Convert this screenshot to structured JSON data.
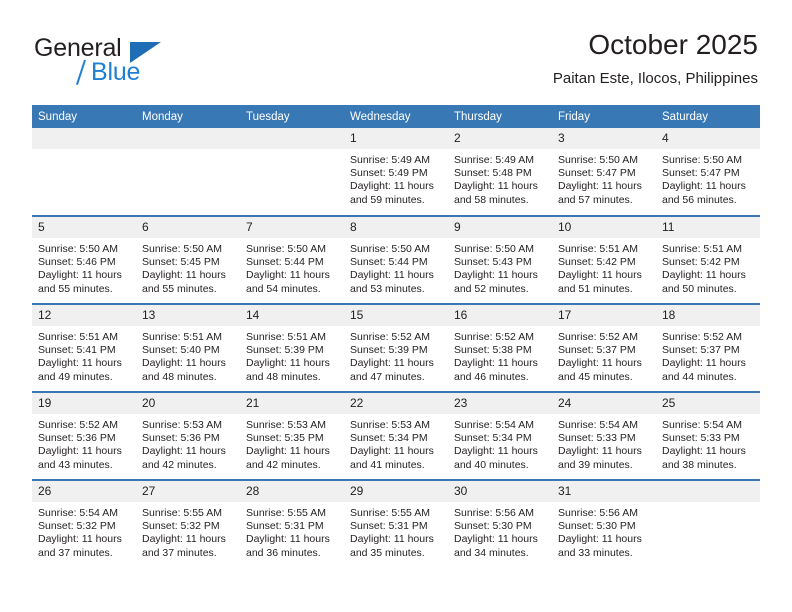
{
  "brand": {
    "name_part1": "General",
    "name_part2": "Blue",
    "triangle_color": "#1f6db5",
    "blue_color": "#1f7fd4"
  },
  "header": {
    "title": "October 2025",
    "subtitle": "Paitan Este, Ilocos, Philippines",
    "header_bg": "#3878b4",
    "daynum_bg": "#f0f0f0"
  },
  "weekday_headers": [
    "Sunday",
    "Monday",
    "Tuesday",
    "Wednesday",
    "Thursday",
    "Friday",
    "Saturday"
  ],
  "weeks": [
    [
      {
        "day": "",
        "sunrise": "",
        "sunset": "",
        "daylight": ""
      },
      {
        "day": "",
        "sunrise": "",
        "sunset": "",
        "daylight": ""
      },
      {
        "day": "",
        "sunrise": "",
        "sunset": "",
        "daylight": ""
      },
      {
        "day": "1",
        "sunrise": "Sunrise: 5:49 AM",
        "sunset": "Sunset: 5:49 PM",
        "daylight": "Daylight: 11 hours and 59 minutes."
      },
      {
        "day": "2",
        "sunrise": "Sunrise: 5:49 AM",
        "sunset": "Sunset: 5:48 PM",
        "daylight": "Daylight: 11 hours and 58 minutes."
      },
      {
        "day": "3",
        "sunrise": "Sunrise: 5:50 AM",
        "sunset": "Sunset: 5:47 PM",
        "daylight": "Daylight: 11 hours and 57 minutes."
      },
      {
        "day": "4",
        "sunrise": "Sunrise: 5:50 AM",
        "sunset": "Sunset: 5:47 PM",
        "daylight": "Daylight: 11 hours and 56 minutes."
      }
    ],
    [
      {
        "day": "5",
        "sunrise": "Sunrise: 5:50 AM",
        "sunset": "Sunset: 5:46 PM",
        "daylight": "Daylight: 11 hours and 55 minutes."
      },
      {
        "day": "6",
        "sunrise": "Sunrise: 5:50 AM",
        "sunset": "Sunset: 5:45 PM",
        "daylight": "Daylight: 11 hours and 55 minutes."
      },
      {
        "day": "7",
        "sunrise": "Sunrise: 5:50 AM",
        "sunset": "Sunset: 5:44 PM",
        "daylight": "Daylight: 11 hours and 54 minutes."
      },
      {
        "day": "8",
        "sunrise": "Sunrise: 5:50 AM",
        "sunset": "Sunset: 5:44 PM",
        "daylight": "Daylight: 11 hours and 53 minutes."
      },
      {
        "day": "9",
        "sunrise": "Sunrise: 5:50 AM",
        "sunset": "Sunset: 5:43 PM",
        "daylight": "Daylight: 11 hours and 52 minutes."
      },
      {
        "day": "10",
        "sunrise": "Sunrise: 5:51 AM",
        "sunset": "Sunset: 5:42 PM",
        "daylight": "Daylight: 11 hours and 51 minutes."
      },
      {
        "day": "11",
        "sunrise": "Sunrise: 5:51 AM",
        "sunset": "Sunset: 5:42 PM",
        "daylight": "Daylight: 11 hours and 50 minutes."
      }
    ],
    [
      {
        "day": "12",
        "sunrise": "Sunrise: 5:51 AM",
        "sunset": "Sunset: 5:41 PM",
        "daylight": "Daylight: 11 hours and 49 minutes."
      },
      {
        "day": "13",
        "sunrise": "Sunrise: 5:51 AM",
        "sunset": "Sunset: 5:40 PM",
        "daylight": "Daylight: 11 hours and 48 minutes."
      },
      {
        "day": "14",
        "sunrise": "Sunrise: 5:51 AM",
        "sunset": "Sunset: 5:39 PM",
        "daylight": "Daylight: 11 hours and 48 minutes."
      },
      {
        "day": "15",
        "sunrise": "Sunrise: 5:52 AM",
        "sunset": "Sunset: 5:39 PM",
        "daylight": "Daylight: 11 hours and 47 minutes."
      },
      {
        "day": "16",
        "sunrise": "Sunrise: 5:52 AM",
        "sunset": "Sunset: 5:38 PM",
        "daylight": "Daylight: 11 hours and 46 minutes."
      },
      {
        "day": "17",
        "sunrise": "Sunrise: 5:52 AM",
        "sunset": "Sunset: 5:37 PM",
        "daylight": "Daylight: 11 hours and 45 minutes."
      },
      {
        "day": "18",
        "sunrise": "Sunrise: 5:52 AM",
        "sunset": "Sunset: 5:37 PM",
        "daylight": "Daylight: 11 hours and 44 minutes."
      }
    ],
    [
      {
        "day": "19",
        "sunrise": "Sunrise: 5:52 AM",
        "sunset": "Sunset: 5:36 PM",
        "daylight": "Daylight: 11 hours and 43 minutes."
      },
      {
        "day": "20",
        "sunrise": "Sunrise: 5:53 AM",
        "sunset": "Sunset: 5:36 PM",
        "daylight": "Daylight: 11 hours and 42 minutes."
      },
      {
        "day": "21",
        "sunrise": "Sunrise: 5:53 AM",
        "sunset": "Sunset: 5:35 PM",
        "daylight": "Daylight: 11 hours and 42 minutes."
      },
      {
        "day": "22",
        "sunrise": "Sunrise: 5:53 AM",
        "sunset": "Sunset: 5:34 PM",
        "daylight": "Daylight: 11 hours and 41 minutes."
      },
      {
        "day": "23",
        "sunrise": "Sunrise: 5:54 AM",
        "sunset": "Sunset: 5:34 PM",
        "daylight": "Daylight: 11 hours and 40 minutes."
      },
      {
        "day": "24",
        "sunrise": "Sunrise: 5:54 AM",
        "sunset": "Sunset: 5:33 PM",
        "daylight": "Daylight: 11 hours and 39 minutes."
      },
      {
        "day": "25",
        "sunrise": "Sunrise: 5:54 AM",
        "sunset": "Sunset: 5:33 PM",
        "daylight": "Daylight: 11 hours and 38 minutes."
      }
    ],
    [
      {
        "day": "26",
        "sunrise": "Sunrise: 5:54 AM",
        "sunset": "Sunset: 5:32 PM",
        "daylight": "Daylight: 11 hours and 37 minutes."
      },
      {
        "day": "27",
        "sunrise": "Sunrise: 5:55 AM",
        "sunset": "Sunset: 5:32 PM",
        "daylight": "Daylight: 11 hours and 37 minutes."
      },
      {
        "day": "28",
        "sunrise": "Sunrise: 5:55 AM",
        "sunset": "Sunset: 5:31 PM",
        "daylight": "Daylight: 11 hours and 36 minutes."
      },
      {
        "day": "29",
        "sunrise": "Sunrise: 5:55 AM",
        "sunset": "Sunset: 5:31 PM",
        "daylight": "Daylight: 11 hours and 35 minutes."
      },
      {
        "day": "30",
        "sunrise": "Sunrise: 5:56 AM",
        "sunset": "Sunset: 5:30 PM",
        "daylight": "Daylight: 11 hours and 34 minutes."
      },
      {
        "day": "31",
        "sunrise": "Sunrise: 5:56 AM",
        "sunset": "Sunset: 5:30 PM",
        "daylight": "Daylight: 11 hours and 33 minutes."
      },
      {
        "day": "",
        "sunrise": "",
        "sunset": "",
        "daylight": ""
      }
    ]
  ]
}
